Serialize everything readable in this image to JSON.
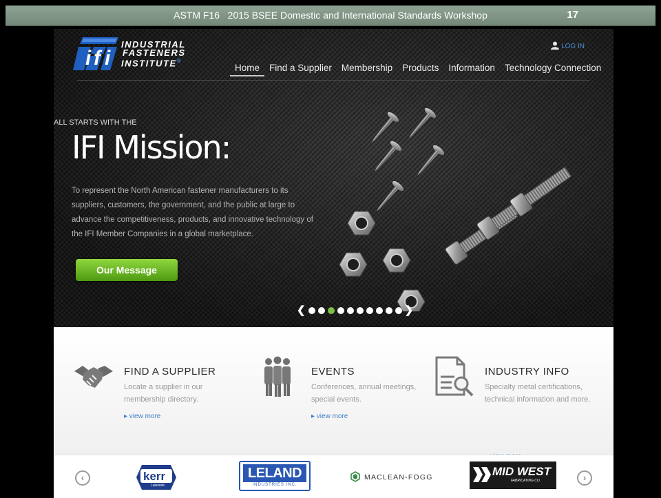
{
  "slide": {
    "title": "ASTM F16   2015 BSEE Domestic and International Standards Workshop",
    "number": "17"
  },
  "logo": {
    "line1": "INDUSTRIAL",
    "line2": "FASTENERS",
    "line3": "INSTITUTE",
    "registered": "®"
  },
  "header": {
    "login_label": "LOG IN",
    "login_icon": "user-icon"
  },
  "nav": {
    "items": [
      "Home",
      "Find a Supplier",
      "Membership",
      "Products",
      "Information",
      "Technology Connection"
    ],
    "active_index": 0
  },
  "hero": {
    "kicker": "ALL STARTS WITH THE",
    "headline": "IFI Mission:",
    "description": "To represent the North American fastener manufacturers to its suppliers, customers, the government, and the public at large to advance the competitiveness, products, and innovative technology of the IFI Member Companies in a global marketplace.",
    "cta_label": "Our Message",
    "carousel": {
      "prev": "❮",
      "next": "❯",
      "dot_count": 10,
      "active_dot": 2
    }
  },
  "features": [
    {
      "icon": "handshake-icon",
      "title": "FIND A SUPPLIER",
      "text": "Locate a supplier in our membership directory.",
      "link": "▸ view more"
    },
    {
      "icon": "people-icon",
      "title": "EVENTS",
      "text": "Conferences, annual meetings, special events.",
      "link": "▸ view more"
    },
    {
      "icon": "document-search-icon",
      "title": "INDUSTRY INFO",
      "text": "Specialty metal certifications, technical information and more.",
      "link": "▸ view more"
    }
  ],
  "partners": {
    "prev": "‹",
    "next": "›",
    "logos": [
      {
        "name": "Kerr",
        "text": "kerr",
        "sub": "Lakeside"
      },
      {
        "name": "Leland",
        "text": "LELAND",
        "sub": "INDUSTRIES INC."
      },
      {
        "name": "Maclean-Fogg",
        "text": "MACLEAN-FOGG"
      },
      {
        "name": "Mid West Fabricating Co.",
        "text": "MID WEST",
        "sub": "FABRICATING CO."
      }
    ]
  },
  "colors": {
    "slide_header": "#82968a",
    "accent_green": "#7ac143",
    "link_blue": "#3f7fc8",
    "hero_bg": "#1b1b1b"
  }
}
